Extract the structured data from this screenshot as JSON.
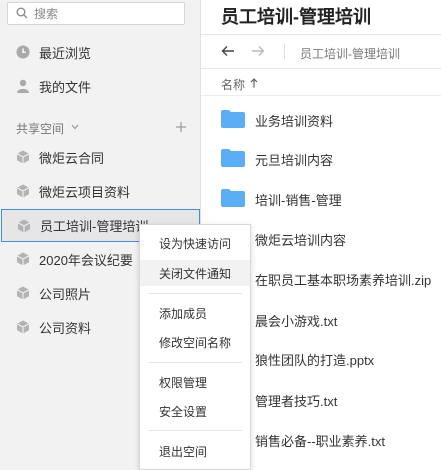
{
  "sidebar": {
    "search_placeholder": "搜索",
    "recent": "最近浏览",
    "my_files": "我的文件",
    "shared_header": "共享空间",
    "spaces": [
      "微炬云合同",
      "微炬云项目资料",
      "员工培训-管理培训",
      "2020年会议纪要",
      "公司照片",
      "公司资料"
    ]
  },
  "main": {
    "title": "员工培训-管理培训",
    "breadcrumb": "员工培训-管理培训",
    "column_name": "名称",
    "files": [
      {
        "name": "业务培训资料",
        "type": "folder"
      },
      {
        "name": "元旦培训内容",
        "type": "folder"
      },
      {
        "name": "培训-销售-管理",
        "type": "folder"
      },
      {
        "name": "微炬云培训内容",
        "type": "folder"
      },
      {
        "name": "在职员工基本职场素养培训.zip",
        "type": "zip"
      },
      {
        "name": "晨会小游戏.txt",
        "type": "txt"
      },
      {
        "name": "狼性团队的打造.pptx",
        "type": "pptx"
      },
      {
        "name": "管理者技巧.txt",
        "type": "txt"
      },
      {
        "name": "销售必备--职业素养.txt",
        "type": "txt"
      }
    ]
  },
  "context_menu": {
    "groups": [
      [
        "设为快速访问",
        "关闭文件通知"
      ],
      [
        "添加成员",
        "修改空间名称"
      ],
      [
        "权限管理",
        "安全设置"
      ],
      [
        "退出空间"
      ]
    ]
  },
  "colors": {
    "accent": "#3e8fe8",
    "folder": "#5aaef5",
    "sidebar_bg": "#f2f2f2"
  }
}
